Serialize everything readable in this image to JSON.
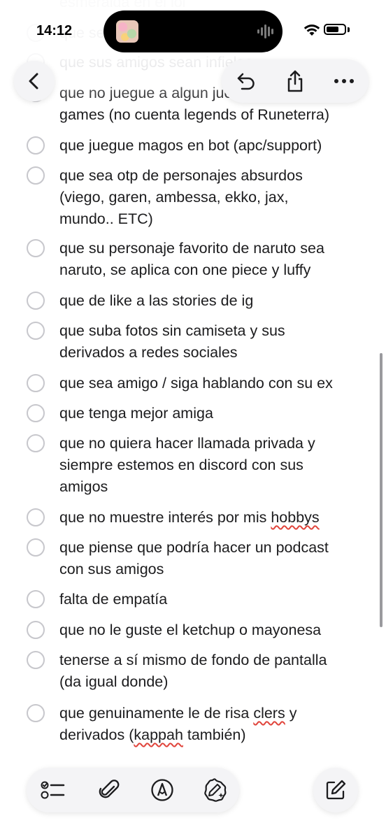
{
  "status_bar": {
    "time": "14:12"
  },
  "checklist": {
    "items": [
      {
        "text": "esmeralda en el lol",
        "faded": true
      },
      {
        "text": "que se...",
        "faded": true
      },
      {
        "text": "que sus amigos sean infieles",
        "faded": true
      },
      {
        "text": "que no juegue a algun juego de fast\ngames (no cuenta legends of Runeterra)",
        "faded": false
      },
      {
        "text": "que juegue magos en bot (apc/support)",
        "faded": false
      },
      {
        "text": "que sea otp de personajes absurdos\n(viego, garen, ambessa, ekko, jax,\nmundo.. ETC)",
        "faded": false
      },
      {
        "text": "que su personaje favorito de naruto sea\nnaruto, se aplica con one piece y luffy",
        "faded": false
      },
      {
        "text": "que de like a las stories de ig",
        "faded": false
      },
      {
        "text": "que suba fotos sin camiseta y sus\nderivados a redes sociales",
        "faded": false
      },
      {
        "text": "que sea amigo / siga hablando con su ex",
        "faded": false
      },
      {
        "text": "que tenga mejor amiga",
        "faded": false
      },
      {
        "text": "que no quiera hacer llamada privada y\nsiempre estemos en discord con sus\namigos",
        "faded": false
      },
      {
        "text": "que no muestre interés por mis hobbys",
        "faded": false
      },
      {
        "text": "que piense que podría hacer un podcast\ncon sus amigos",
        "faded": false
      },
      {
        "text": "falta de empatía",
        "faded": false
      },
      {
        "text": "que no le guste el ketchup o mayonesa",
        "faded": false
      },
      {
        "text": "tenerse a sí mismo de fondo de pantalla\n(da igual donde)",
        "faded": false
      },
      {
        "text": "que genuinamente le de risa clers y\nderivados (kappah también)",
        "faded": false
      }
    ]
  },
  "icons": {
    "back": "chevron-left-icon",
    "undo": "undo-icon",
    "share": "share-icon",
    "more": "ellipsis-icon",
    "checklist": "checklist-icon",
    "attach": "paperclip-icon",
    "markup": "pen-markup-icon",
    "ai": "apple-intelligence-icon",
    "compose": "compose-icon"
  },
  "colors": {
    "circle_border": "#c7c7cc",
    "text": "#1c1c1e",
    "faded_text": "#c8c8cc",
    "button_bg": "#f4f4f6",
    "spell_underline": "#e0443b"
  }
}
